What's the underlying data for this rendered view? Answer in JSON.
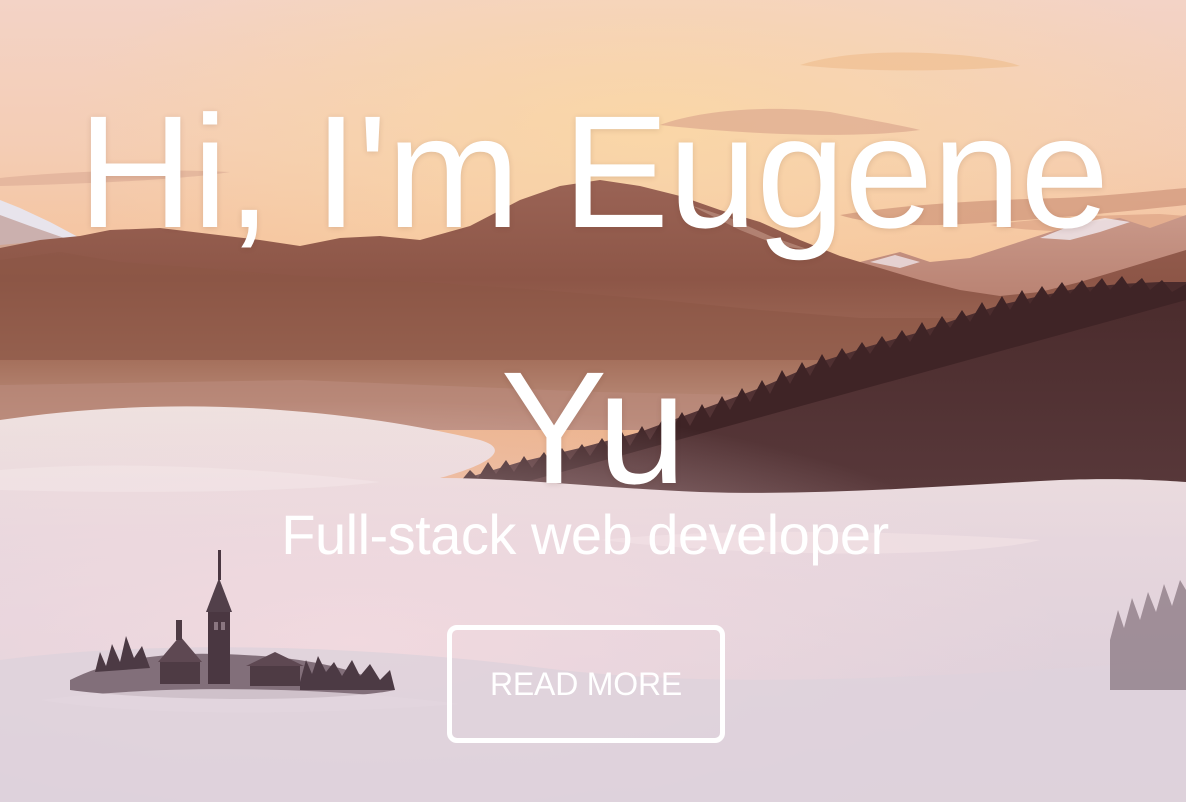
{
  "hero": {
    "title": "Hi, I'm Eugene Yu",
    "subtitle": "Full-stack web developer",
    "cta_label": "READ MORE",
    "background": "mountain-sunrise-fog-photo"
  },
  "colors": {
    "text": "#ffffff",
    "sky_top": "#f2d2c3",
    "sky_mid": "#f5c29a",
    "mountain": "#8e5a4b",
    "forest": "#3e2528",
    "fog": "#e8dde6"
  }
}
